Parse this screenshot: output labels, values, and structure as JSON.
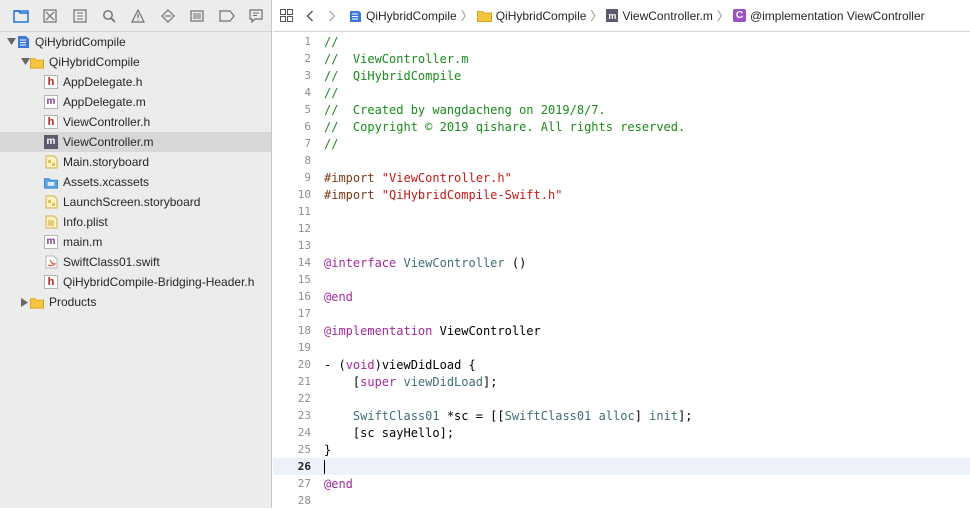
{
  "navigator": {
    "items": [
      {
        "label": "QiHybridCompile",
        "icon": "project-icon",
        "level": 0,
        "disclosure": "open"
      },
      {
        "label": "QiHybridCompile",
        "icon": "folder-icon",
        "level": 1,
        "disclosure": "open"
      },
      {
        "label": "AppDelegate.h",
        "icon": "h-file-icon",
        "level": 2
      },
      {
        "label": "AppDelegate.m",
        "icon": "m-file-icon",
        "level": 2
      },
      {
        "label": "ViewController.h",
        "icon": "h-file-icon",
        "level": 2
      },
      {
        "label": "ViewController.m",
        "icon": "m-file-icon",
        "level": 2,
        "selected": true
      },
      {
        "label": "Main.storyboard",
        "icon": "storyboard-icon",
        "level": 2
      },
      {
        "label": "Assets.xcassets",
        "icon": "assets-icon",
        "level": 2
      },
      {
        "label": "LaunchScreen.storyboard",
        "icon": "storyboard-icon",
        "level": 2
      },
      {
        "label": "Info.plist",
        "icon": "plist-icon",
        "level": 2
      },
      {
        "label": "main.m",
        "icon": "m-file-icon",
        "level": 2
      },
      {
        "label": "SwiftClass01.swift",
        "icon": "swift-file-icon",
        "level": 2
      },
      {
        "label": "QiHybridCompile-Bridging-Header.h",
        "icon": "h-file-icon",
        "level": 2
      },
      {
        "label": "Products",
        "icon": "folder-icon",
        "level": 1,
        "disclosure": "closed"
      }
    ]
  },
  "jumpbar": {
    "crumbs": [
      "QiHybridCompile",
      "QiHybridCompile",
      "ViewController.m",
      "@implementation ViewController"
    ]
  },
  "editor": {
    "current_line": 26,
    "lines": [
      {
        "n": "1",
        "tokens": [
          [
            "c-com",
            "//"
          ]
        ]
      },
      {
        "n": "2",
        "tokens": [
          [
            "c-com",
            "//  ViewController.m"
          ]
        ]
      },
      {
        "n": "3",
        "tokens": [
          [
            "c-com",
            "//  QiHybridCompile"
          ]
        ]
      },
      {
        "n": "4",
        "tokens": [
          [
            "c-com",
            "//"
          ]
        ]
      },
      {
        "n": "5",
        "tokens": [
          [
            "c-com",
            "//  Created by wangdacheng on 2019/8/7."
          ]
        ]
      },
      {
        "n": "6",
        "tokens": [
          [
            "c-com",
            "//  Copyright © 2019 qishare. All rights reserved."
          ]
        ]
      },
      {
        "n": "7",
        "tokens": [
          [
            "c-com",
            "//"
          ]
        ]
      },
      {
        "n": "8",
        "tokens": []
      },
      {
        "n": "9",
        "tokens": [
          [
            "c-pre",
            "#import "
          ],
          [
            "c-str",
            "\"ViewController.h\""
          ]
        ]
      },
      {
        "n": "10",
        "tokens": [
          [
            "c-pre",
            "#import "
          ],
          [
            "c-str",
            "\"QiHybridCompile-Swift.h\""
          ]
        ]
      },
      {
        "n": "11",
        "tokens": []
      },
      {
        "n": "12",
        "tokens": []
      },
      {
        "n": "13",
        "tokens": []
      },
      {
        "n": "14",
        "tokens": [
          [
            "c-kw",
            "@interface "
          ],
          [
            "c-cls",
            "ViewController"
          ],
          [
            "c-plain",
            " ()"
          ]
        ]
      },
      {
        "n": "15",
        "tokens": []
      },
      {
        "n": "16",
        "tokens": [
          [
            "c-kw",
            "@end"
          ]
        ]
      },
      {
        "n": "17",
        "tokens": []
      },
      {
        "n": "18",
        "tokens": [
          [
            "c-kw",
            "@implementation "
          ],
          [
            "c-plain",
            "ViewController"
          ]
        ]
      },
      {
        "n": "19",
        "tokens": []
      },
      {
        "n": "20",
        "tokens": [
          [
            "c-plain",
            "- ("
          ],
          [
            "c-kw",
            "void"
          ],
          [
            "c-plain",
            ")viewDidLoad {"
          ]
        ]
      },
      {
        "n": "21",
        "tokens": [
          [
            "c-plain",
            "    ["
          ],
          [
            "c-kw",
            "super"
          ],
          [
            "c-plain",
            " "
          ],
          [
            "c-cls",
            "viewDidLoad"
          ],
          [
            "c-plain",
            "];"
          ]
        ]
      },
      {
        "n": "22",
        "tokens": []
      },
      {
        "n": "23",
        "tokens": [
          [
            "c-plain",
            "    "
          ],
          [
            "c-cls",
            "SwiftClass01"
          ],
          [
            "c-plain",
            " *sc = [["
          ],
          [
            "c-cls",
            "SwiftClass01"
          ],
          [
            "c-plain",
            " "
          ],
          [
            "c-cls",
            "alloc"
          ],
          [
            "c-plain",
            "] "
          ],
          [
            "c-cls",
            "init"
          ],
          [
            "c-plain",
            "];"
          ]
        ]
      },
      {
        "n": "24",
        "tokens": [
          [
            "c-plain",
            "    [sc sayHello];"
          ]
        ]
      },
      {
        "n": "25",
        "tokens": [
          [
            "c-plain",
            "}"
          ]
        ]
      },
      {
        "n": "26",
        "tokens": []
      },
      {
        "n": "27",
        "tokens": [
          [
            "c-kw",
            "@end"
          ]
        ]
      },
      {
        "n": "28",
        "tokens": []
      }
    ]
  },
  "toolbar": {
    "icons": [
      "project-navigator-icon",
      "source-control-icon",
      "symbol-navigator-icon",
      "find-navigator-icon",
      "issue-navigator-icon",
      "test-navigator-icon",
      "debug-navigator-icon",
      "breakpoint-navigator-icon",
      "report-navigator-icon"
    ]
  },
  "colors": {
    "selection": "#d8d8d8",
    "accent": "#1a6ddb",
    "comment": "#1b8a1b",
    "string": "#c41a16",
    "keyword": "#a32a9a",
    "class": "#3f6e74"
  }
}
